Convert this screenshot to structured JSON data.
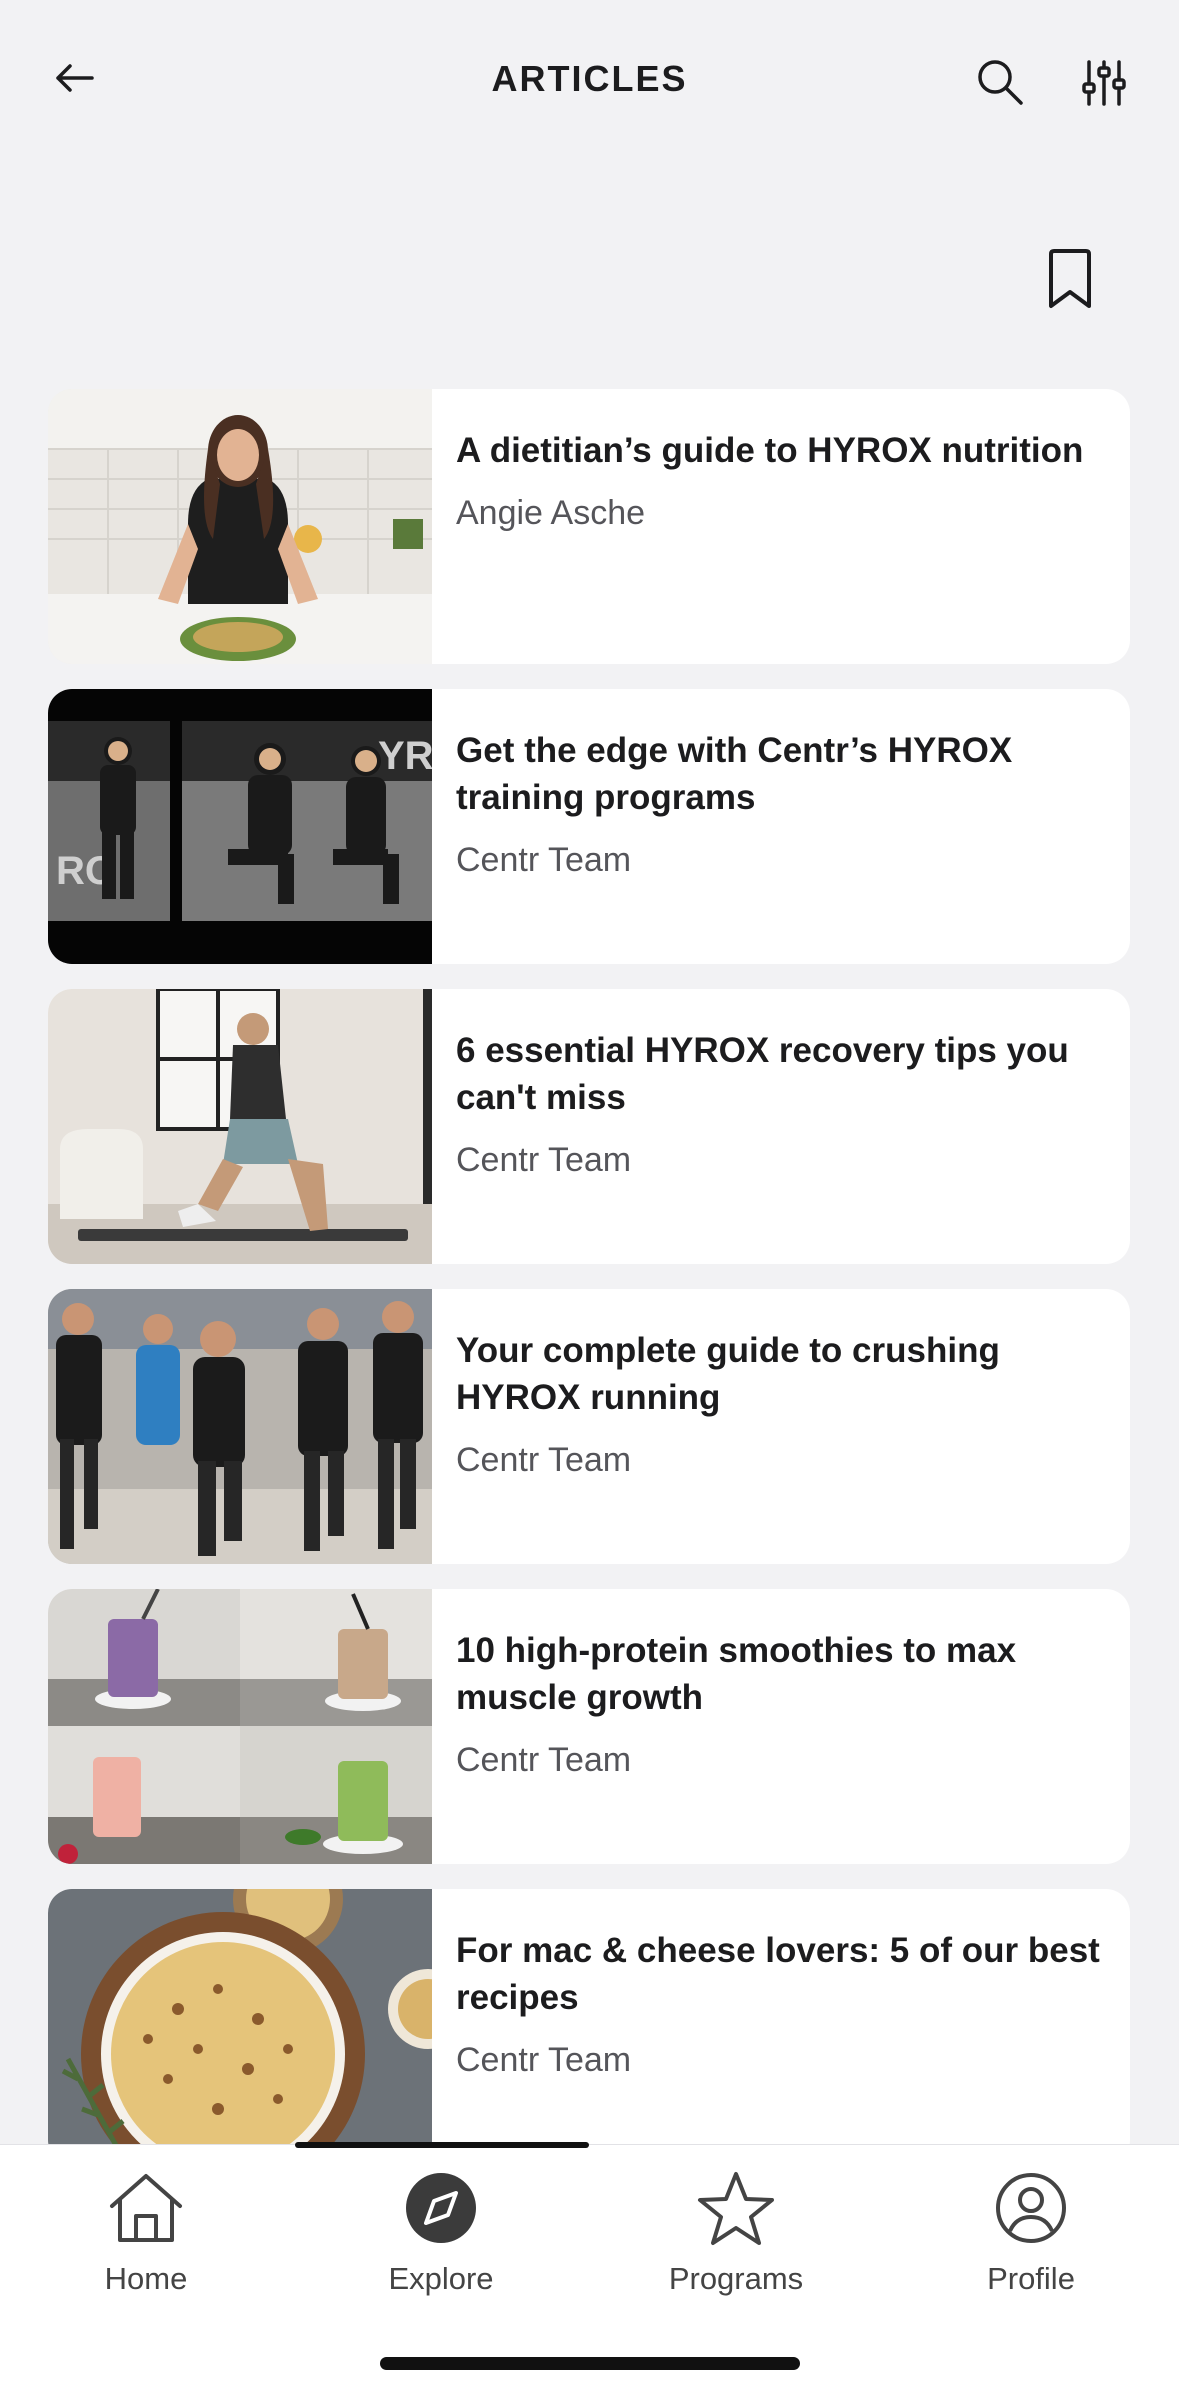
{
  "header": {
    "title": "ARTICLES"
  },
  "articles": [
    {
      "title": "A dietitian’s guide to HYROX nutrition",
      "author": "Angie Asche"
    },
    {
      "title": "Get the edge with Centr’s HYROX training programs",
      "author": "Centr Team"
    },
    {
      "title": "6 essential HYROX recovery tips you can't miss",
      "author": "Centr Team"
    },
    {
      "title": "Your complete guide to crushing HYROX running",
      "author": "Centr Team"
    },
    {
      "title": "10 high-protein smoothies to max muscle growth",
      "author": "Centr Team"
    },
    {
      "title": "For mac & cheese lovers: 5 of our best recipes",
      "author": "Centr Team"
    }
  ],
  "tabs": [
    {
      "label": "Home",
      "icon": "home-icon"
    },
    {
      "label": "Explore",
      "icon": "compass-icon"
    },
    {
      "label": "Programs",
      "icon": "star-icon"
    },
    {
      "label": "Profile",
      "icon": "user-icon"
    }
  ],
  "colors": {
    "background": "#f2f2f4",
    "card": "#ffffff",
    "text": "#1c1c1e",
    "secondary": "#55555a"
  }
}
